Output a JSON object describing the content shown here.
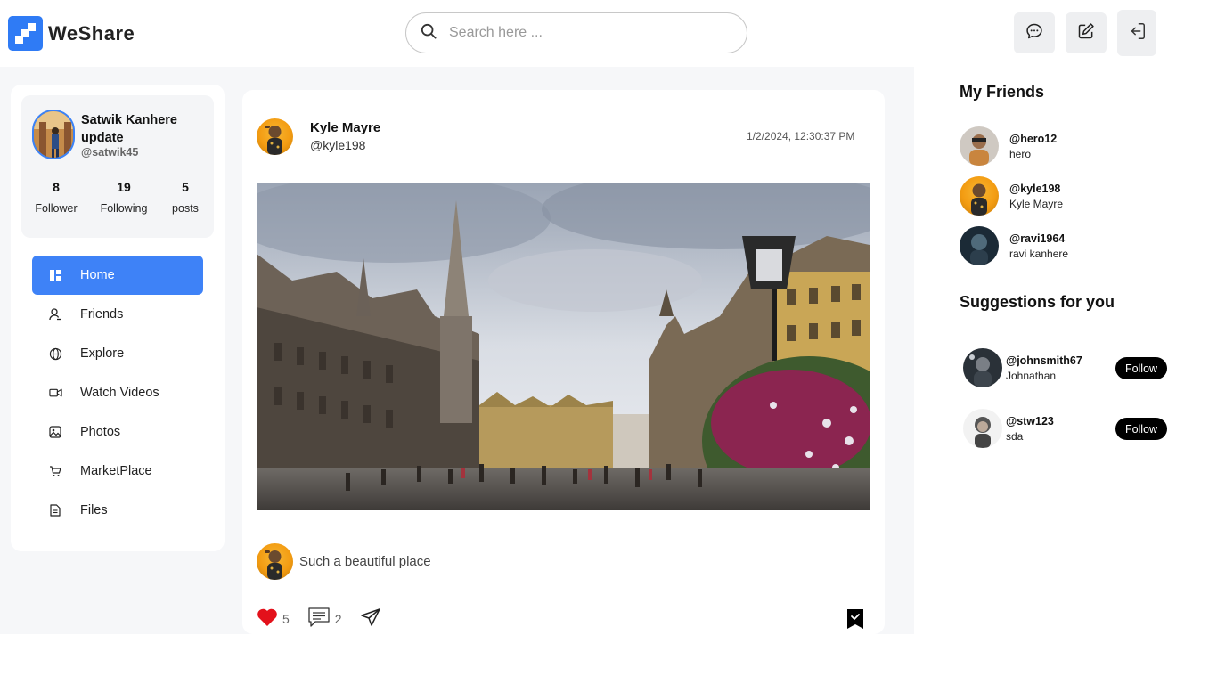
{
  "app": {
    "name": "WeShare",
    "brand_color": "#2f7bf5"
  },
  "search": {
    "placeholder": "Search here ..."
  },
  "header_actions": [
    {
      "name": "messages",
      "icon": "chat-icon"
    },
    {
      "name": "create-post",
      "icon": "edit-icon"
    },
    {
      "name": "logout",
      "icon": "logout-icon"
    }
  ],
  "profile": {
    "name": "Satwik Kanhere update",
    "handle": "@satwik45",
    "stats": [
      {
        "value": "8",
        "label": "Follower"
      },
      {
        "value": "19",
        "label": "Following"
      },
      {
        "value": "5",
        "label": "posts"
      }
    ]
  },
  "nav": [
    {
      "label": "Home",
      "icon": "home-icon",
      "active": true
    },
    {
      "label": "Friends",
      "icon": "user-icon",
      "active": false
    },
    {
      "label": "Explore",
      "icon": "globe-icon",
      "active": false
    },
    {
      "label": "Watch Videos",
      "icon": "video-icon",
      "active": false
    },
    {
      "label": "Photos",
      "icon": "image-icon",
      "active": false
    },
    {
      "label": "MarketPlace",
      "icon": "cart-icon",
      "active": false
    },
    {
      "label": "Files",
      "icon": "file-icon",
      "active": false
    }
  ],
  "post": {
    "author_name": "Kyle Mayre",
    "author_handle": "@kyle198",
    "timestamp": "1/2/2024, 12:30:37 PM",
    "caption": "Such a beautiful place",
    "likes": "5",
    "comments": "2"
  },
  "friends": {
    "title": "My Friends",
    "items": [
      {
        "handle": "@hero12",
        "name": "hero"
      },
      {
        "handle": "@kyle198",
        "name": "Kyle Mayre"
      },
      {
        "handle": "@ravi1964",
        "name": "ravi kanhere"
      }
    ]
  },
  "suggestions": {
    "title": "Suggestions for you",
    "follow_label": "Follow",
    "items": [
      {
        "handle": "@johnsmith67",
        "name": "Johnathan"
      },
      {
        "handle": "@stw123",
        "name": "sda"
      }
    ]
  }
}
